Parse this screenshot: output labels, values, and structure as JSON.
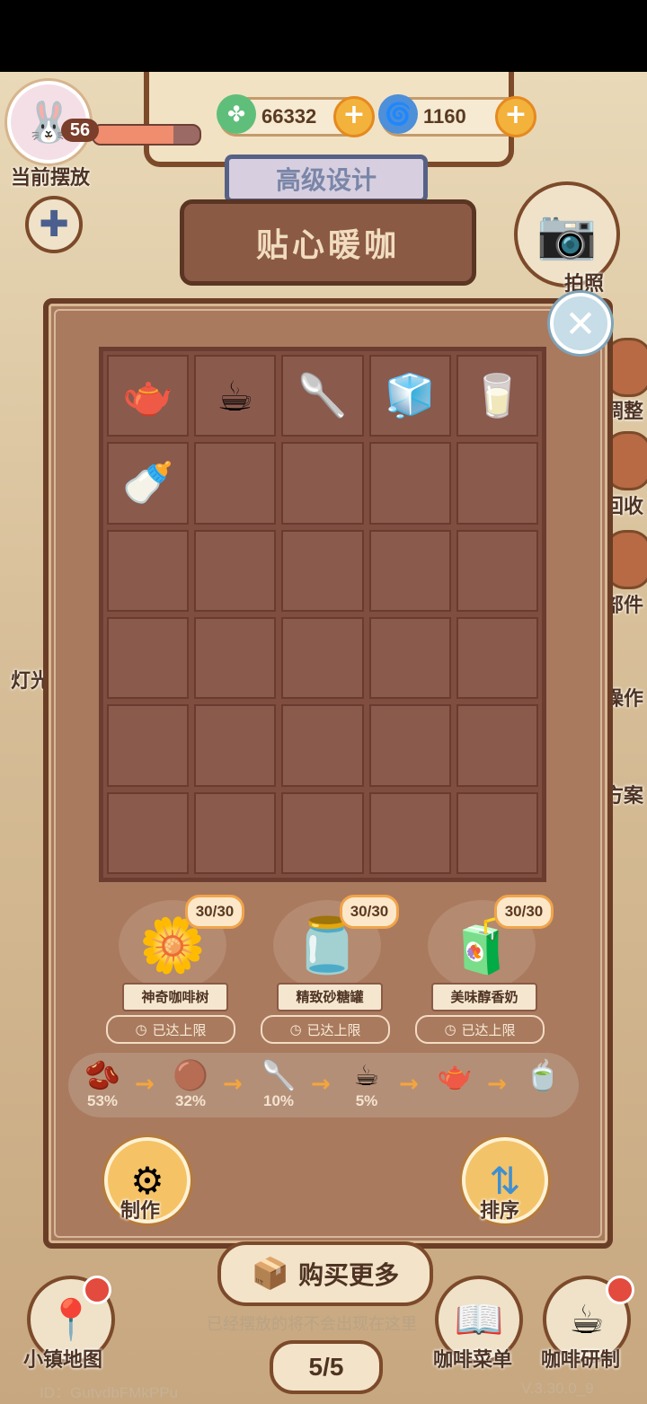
{
  "hud": {
    "level": "56",
    "xp_fraction": 0.75,
    "currency_green": {
      "icon": "clover-icon",
      "value": "66332"
    },
    "currency_blue": {
      "icon": "swirl-icon",
      "value": "1160"
    },
    "current_placement_label": "当前摆放",
    "photo_label": "拍照",
    "light_label": "灯光"
  },
  "background": {
    "sub_banner": "高级设计",
    "banner_title": "贴心暖咖",
    "right_labels": [
      "调整",
      "回收",
      "部件",
      "操作",
      "方案"
    ]
  },
  "inventory": {
    "rows": 6,
    "cols": 5,
    "items": [
      {
        "name": "coffee-pitcher-icon",
        "glyph": "🫖"
      },
      {
        "name": "latte-cup-icon",
        "glyph": "☕"
      },
      {
        "name": "ground-coffee-spoon-icon",
        "glyph": "🥄"
      },
      {
        "name": "sugar-cubes-icon",
        "glyph": "🧊"
      },
      {
        "name": "milk-jug-icon",
        "glyph": "🥛"
      },
      {
        "name": "milk-bottle-icon",
        "glyph": "🍼"
      }
    ]
  },
  "sources": [
    {
      "name": "神奇咖啡树",
      "count": "30/30",
      "status": "已达上限",
      "icon": "coffee-tree-icon",
      "glyph": "🌼"
    },
    {
      "name": "精致砂糖罐",
      "count": "30/30",
      "status": "已达上限",
      "icon": "sugar-jar-icon",
      "glyph": "🫙"
    },
    {
      "name": "美味醇香奶",
      "count": "30/30",
      "status": "已达上限",
      "icon": "milk-carton-icon",
      "glyph": "🧃"
    }
  ],
  "chain": [
    {
      "icon": "coffee-bean-icon",
      "glyph": "🫘",
      "pct": "53%"
    },
    {
      "icon": "roasted-beans-icon",
      "glyph": "🟤",
      "pct": "32%"
    },
    {
      "icon": "ground-coffee-icon",
      "glyph": "🥄",
      "pct": "10%"
    },
    {
      "icon": "latte-icon",
      "glyph": "☕",
      "pct": "5%"
    },
    {
      "icon": "pitcher-icon",
      "glyph": "🫖",
      "pct": ""
    },
    {
      "icon": "espresso-set-icon",
      "glyph": "🍵",
      "pct": ""
    }
  ],
  "actions": {
    "make_label": "制作",
    "sort_label": "排序"
  },
  "footer": {
    "buy_more_label": "购买更多",
    "hint": "已经摆放的将不会出现在这里",
    "page": "5/5",
    "map_label": "小镇地图",
    "menu_label": "咖啡菜单",
    "research_label": "咖啡研制",
    "id_text": "ID：GutvdbFMkPPu",
    "version": "V.3.30.0_9"
  },
  "colors": {
    "panel": "#a97a5e",
    "grid": "#7f4e40",
    "accent": "#f2b23c"
  }
}
